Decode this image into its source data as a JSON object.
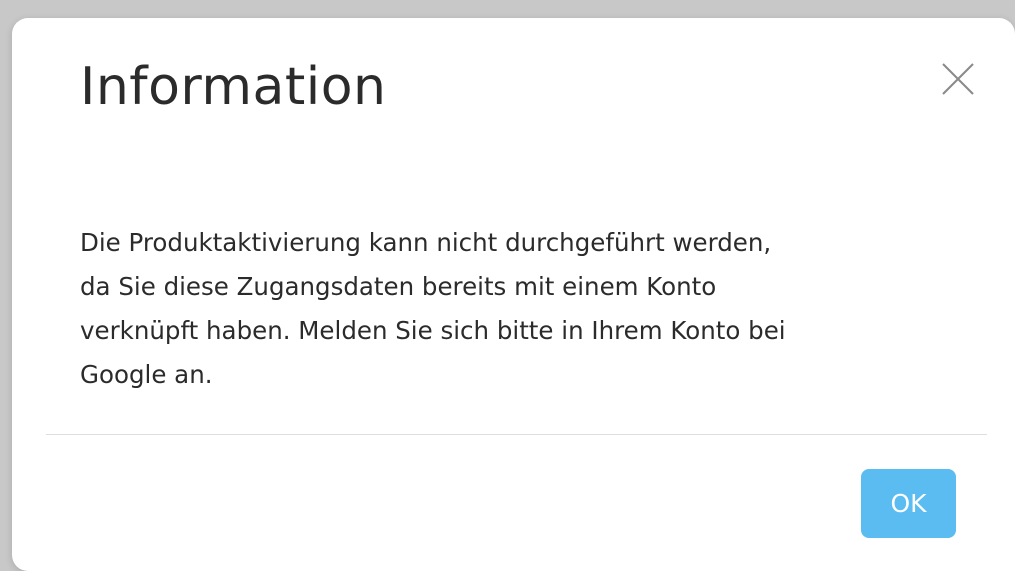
{
  "dialog": {
    "title": "Information",
    "close_icon": "close-icon",
    "message_lines": [
      "Die Produktaktivierung kann nicht durchgeführt werden,",
      "da Sie diese Zugangsdaten bereits mit einem Konto",
      "verknüpft haben. Melden Sie sich bitte in Ihrem Konto bei",
      "Google an."
    ],
    "ok_label": "OK"
  },
  "colors": {
    "backdrop": "#c8c8c8",
    "dialog_background": "#ffffff",
    "text": "#2b2b2b",
    "close_icon": "#8a8a8a",
    "divider": "#dedede",
    "ok_button": "#5bbcf2",
    "ok_button_text": "#ffffff"
  }
}
